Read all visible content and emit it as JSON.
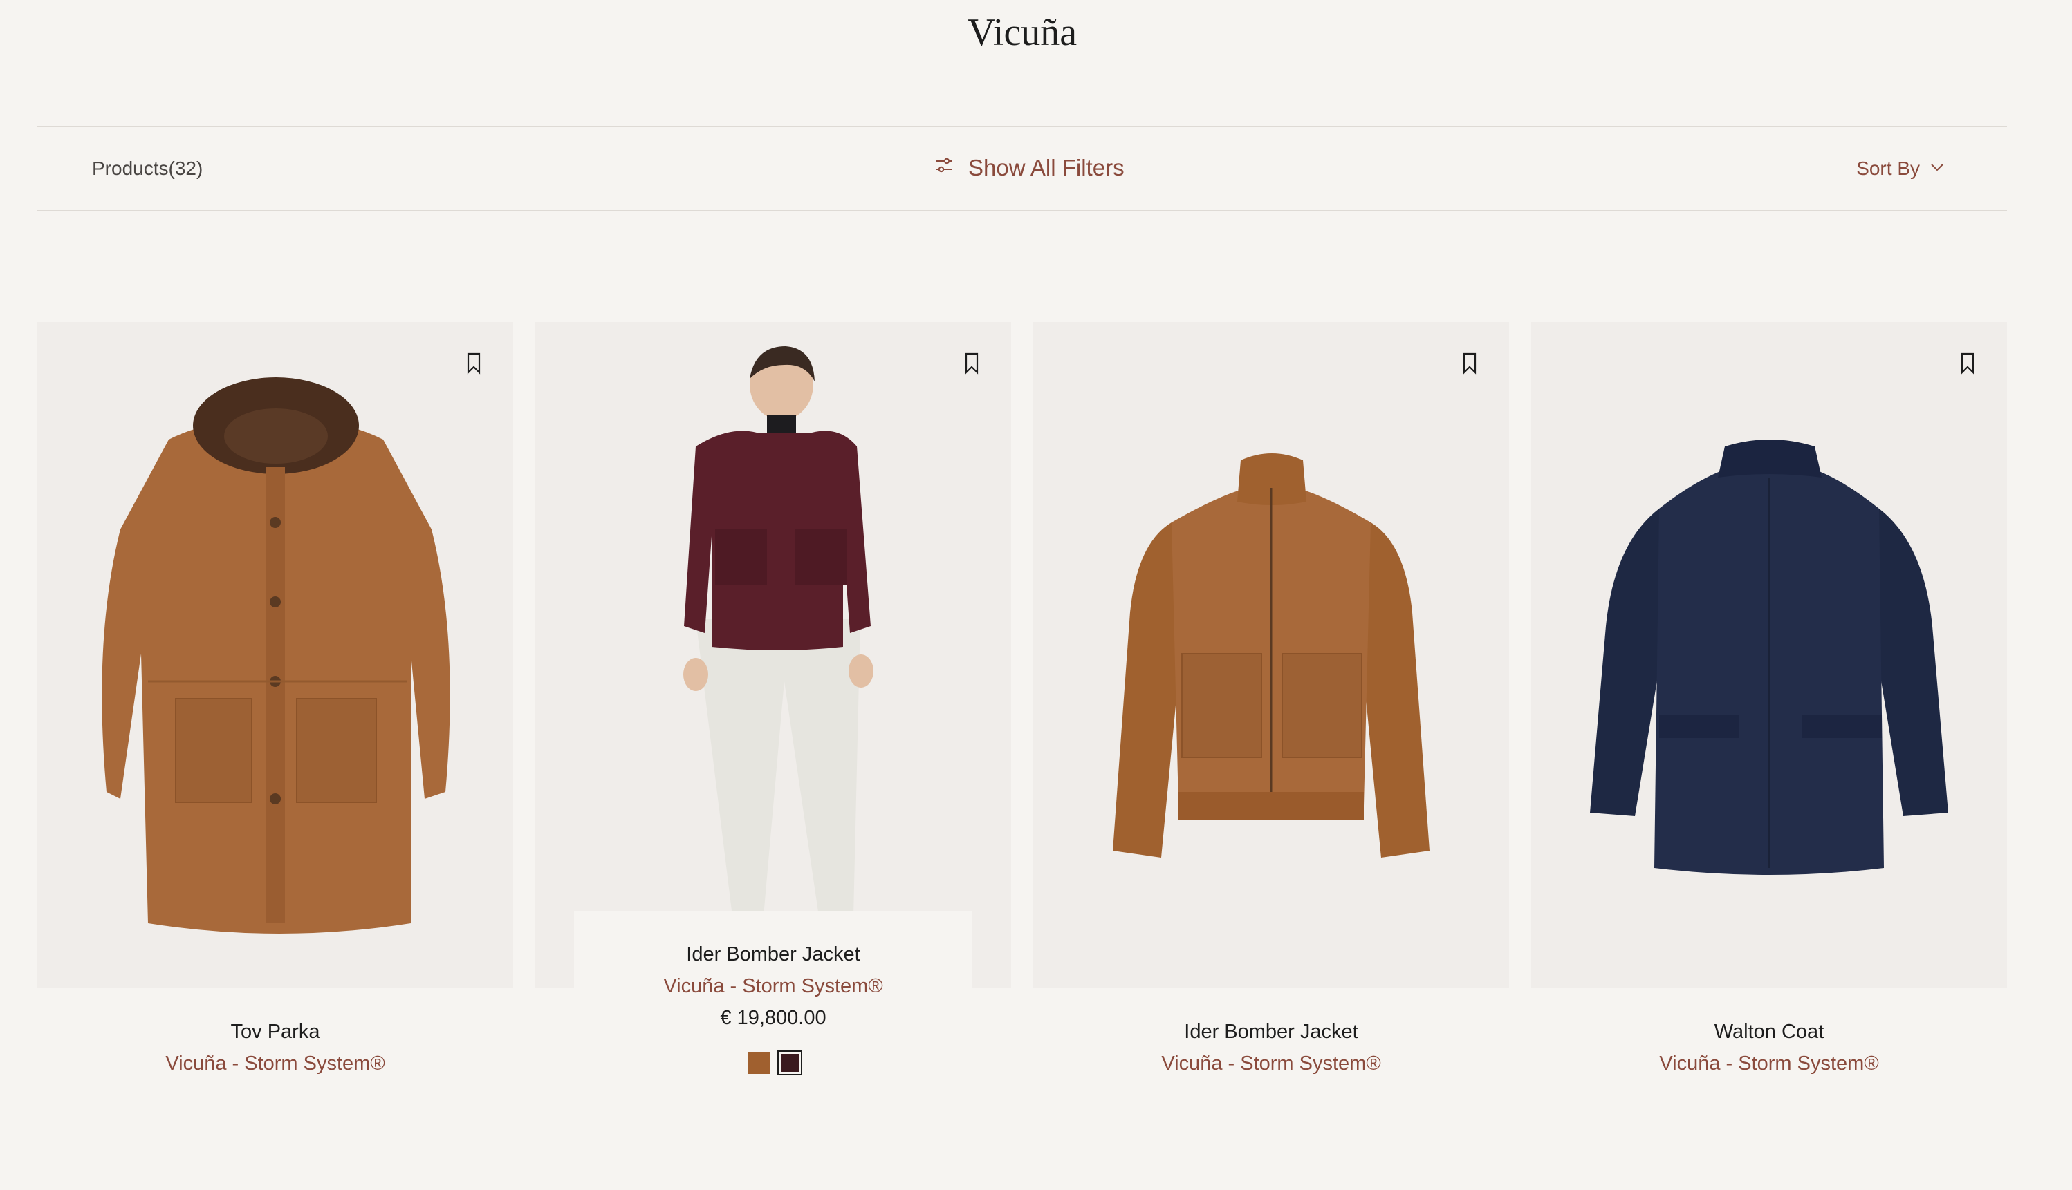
{
  "page": {
    "title": "Vicuña"
  },
  "toolbar": {
    "products_label": "Products(32)",
    "filters_label": "Show All Filters",
    "sort_label": "Sort By"
  },
  "colors": {
    "accent": "#8a4a3c",
    "background": "#f6f4f1",
    "image_background": "#f0edea"
  },
  "products": [
    {
      "name": "Tov Parka",
      "material": "Vicuña - Storm System®",
      "image": "brown-parka-with-fur-hood",
      "color": "#a8693a"
    },
    {
      "name": "Ider Bomber Jacket",
      "material": "Vicuña - Storm System®",
      "price": "€ 19,800.00",
      "image": "model-wearing-burgundy-bomber",
      "swatches": [
        "#a0602f",
        "#3a1a1f"
      ],
      "selected_swatch": 1
    },
    {
      "name": "Ider Bomber Jacket",
      "material": "Vicuña - Storm System®",
      "image": "tan-bomber-jacket",
      "color": "#a8693a"
    },
    {
      "name": "Walton Coat",
      "material": "Vicuña - Storm System®",
      "image": "navy-coat",
      "color": "#1e2843"
    }
  ],
  "icons": {
    "filters": "sliders-icon",
    "sort": "chevron-down-icon",
    "wishlist": "bookmark-icon"
  }
}
